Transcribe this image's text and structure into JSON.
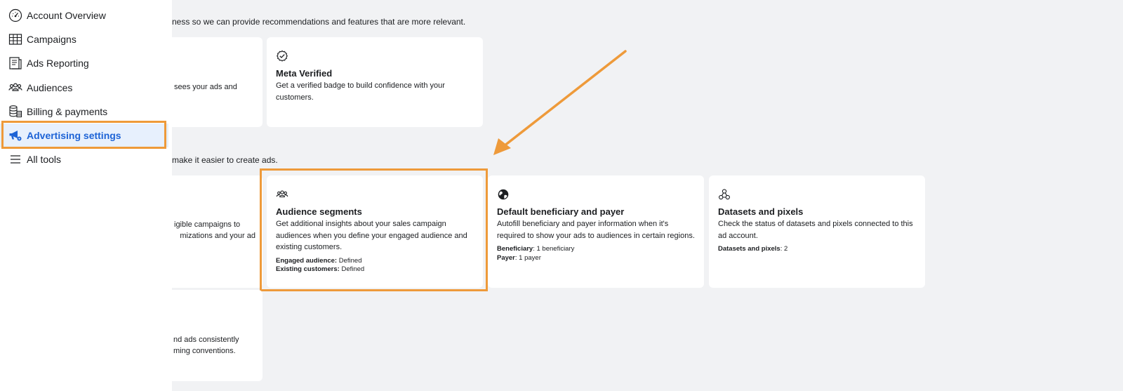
{
  "sidebar": {
    "items": [
      {
        "label": "Account Overview",
        "icon": "dashboard-gauge-icon"
      },
      {
        "label": "Campaigns",
        "icon": "table-grid-icon"
      },
      {
        "label": "Ads Reporting",
        "icon": "report-document-icon"
      },
      {
        "label": "Audiences",
        "icon": "people-group-icon"
      },
      {
        "label": "Billing & payments",
        "icon": "coins-stack-icon"
      },
      {
        "label": "Advertising settings",
        "icon": "megaphone-gear-icon",
        "active": true
      },
      {
        "label": "All tools",
        "icon": "hamburger-menu-icon"
      }
    ]
  },
  "sections": {
    "business_desc_partial": "ness so we can provide recommendations and features that are more relevant.",
    "ads_desc_partial": "make it easier to create ads."
  },
  "cards": {
    "left_top_partial": [
      "sees your ads and"
    ],
    "meta_verified": {
      "title": "Meta Verified",
      "desc": "Get a verified badge to build confidence with your customers."
    },
    "left_mid_partial": [
      "igible campaigns to",
      "mizations and your ad"
    ],
    "audience_segments": {
      "title": "Audience segments",
      "desc": "Get additional insights about your sales campaign audiences when you define your engaged audience and existing customers.",
      "meta1_label": "Engaged audience:",
      "meta1_value": " Defined",
      "meta2_label": "Existing customers:",
      "meta2_value": " Defined"
    },
    "default_beneficiary": {
      "title": "Default beneficiary and payer",
      "desc": "Autofill beneficiary and payer information when it's required to show your ads to audiences in certain regions.",
      "meta1_label": "Beneficiary",
      "meta1_value": ": 1 beneficiary",
      "meta2_label": "Payer",
      "meta2_value": ": 1 payer"
    },
    "datasets": {
      "title": "Datasets and pixels",
      "desc": "Check the status of datasets and pixels connected to this ad account.",
      "meta1_label": "Datasets and pixels",
      "meta1_value": ": 2"
    },
    "left_bottom_partial": [
      "nd ads consistently",
      "ming conventions."
    ]
  },
  "colors": {
    "accent_blue": "#1d63d6",
    "highlight_orange": "#ee9a3a",
    "background": "#f1f2f4"
  }
}
